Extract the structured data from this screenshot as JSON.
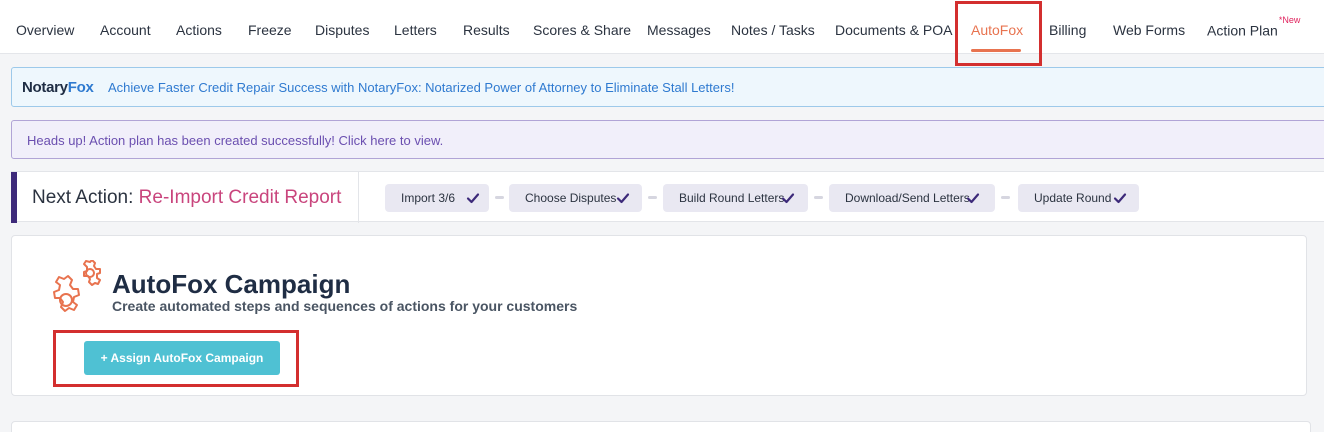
{
  "nav": {
    "tabs": [
      {
        "label": "Overview"
      },
      {
        "label": "Account"
      },
      {
        "label": "Actions"
      },
      {
        "label": "Freeze"
      },
      {
        "label": "Disputes"
      },
      {
        "label": "Letters"
      },
      {
        "label": "Results"
      },
      {
        "label": "Scores & Share"
      },
      {
        "label": "Messages"
      },
      {
        "label": "Notes / Tasks"
      },
      {
        "label": "Documents & POA"
      },
      {
        "label": "AutoFox"
      },
      {
        "label": "Billing"
      },
      {
        "label": "Web Forms"
      },
      {
        "label": "Action Plan",
        "badge": "*New"
      }
    ],
    "active_tab": "AutoFox"
  },
  "notary_banner": {
    "logo_part1": "Notary",
    "logo_part2": "Fox",
    "text": "Achieve Faster Credit Repair Success with NotaryFox: Notarized Power of Attorney to Eliminate Stall Letters!"
  },
  "plan_banner": {
    "text": "Heads up! Action plan has been created successfully! Click here to view."
  },
  "next_action": {
    "label": "Next Action:",
    "value": "Re-Import Credit Report",
    "steps": [
      {
        "label": "Import 3/6",
        "done": true
      },
      {
        "label": "Choose Disputes",
        "done": true
      },
      {
        "label": "Build Round Letters",
        "done": true
      },
      {
        "label": "Download/Send Letters",
        "done": true
      },
      {
        "label": "Update Round",
        "done": true
      }
    ]
  },
  "autofox": {
    "icon": "gears-icon",
    "title": "AutoFox Campaign",
    "subtitle": "Create automated steps and sequences of actions for your customers",
    "button_label": "+ Assign AutoFox Campaign"
  },
  "colors": {
    "accent_orange": "#e8734f",
    "highlight_red": "#d32f2f",
    "button_teal": "#4fc1d3",
    "next_action_pink": "#c9457d",
    "accent_purple": "#3d2a7a"
  }
}
